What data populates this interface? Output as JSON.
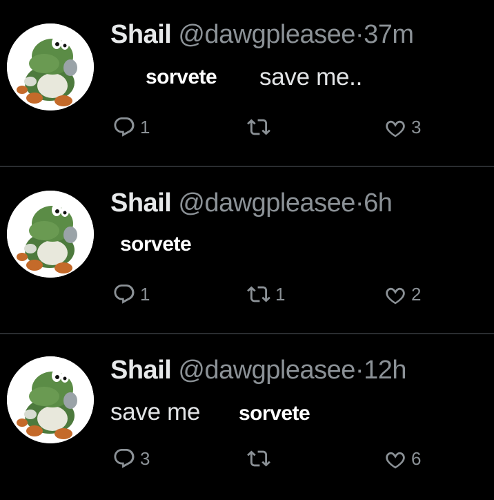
{
  "tweets": [
    {
      "name": "Shail",
      "handle": "@dawgpleasee",
      "separator": "·",
      "time": "37m",
      "overlay_text": "sorvete",
      "text": "save me..",
      "replies": "1",
      "retweets": "",
      "likes": "3"
    },
    {
      "name": "Shail",
      "handle": "@dawgpleasee",
      "separator": "·",
      "time": "6h",
      "overlay_text": "sorvete",
      "text": "",
      "replies": "1",
      "retweets": "1",
      "likes": "2"
    },
    {
      "name": "Shail",
      "handle": "@dawgpleasee",
      "separator": "·",
      "time": "12h",
      "text": "save me",
      "overlay_text": "sorvete",
      "replies": "3",
      "retweets": "",
      "likes": "6"
    }
  ],
  "icons": {
    "avatar": "yoshi-avatar",
    "reply": "reply-icon",
    "retweet": "retweet-icon",
    "like": "heart-icon"
  },
  "colors": {
    "background": "#000000",
    "muted": "#8b9196",
    "divider": "#2a2d30"
  }
}
